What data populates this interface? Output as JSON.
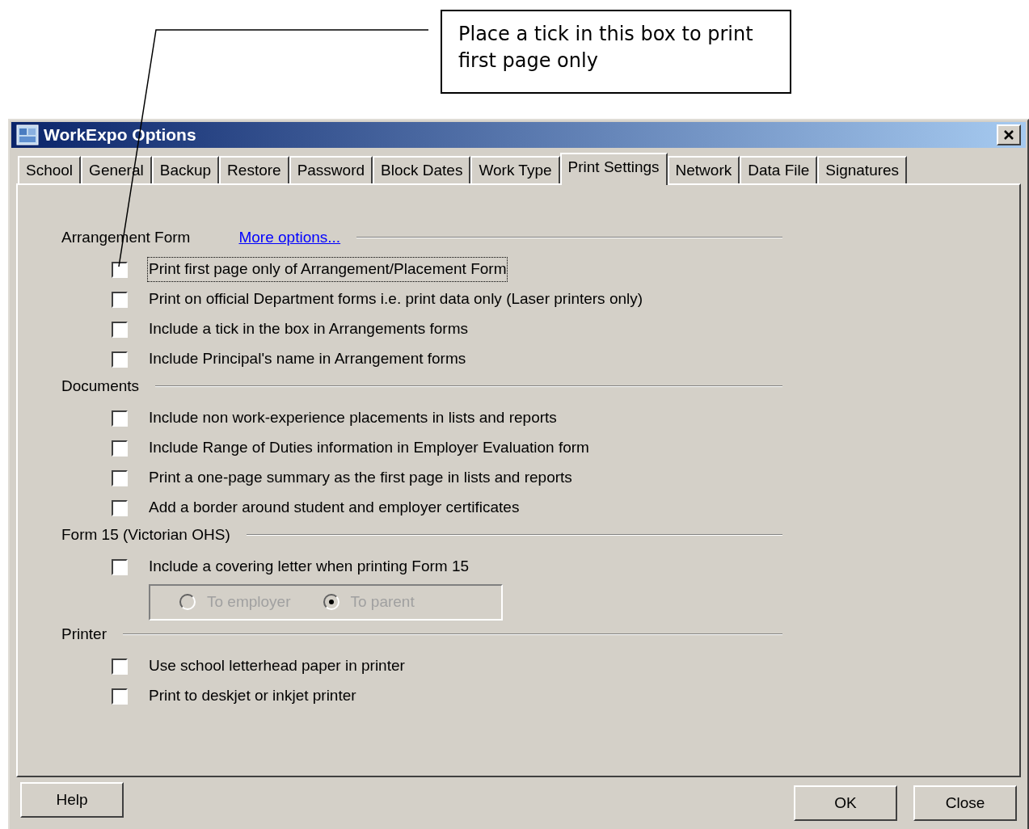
{
  "callout": {
    "text": "Place a tick in this box to print first page only"
  },
  "dialog": {
    "title": "WorkExpo Options",
    "tabs": [
      {
        "label": "School",
        "selected": false
      },
      {
        "label": "General",
        "selected": false
      },
      {
        "label": "Backup",
        "selected": false
      },
      {
        "label": "Restore",
        "selected": false
      },
      {
        "label": "Password",
        "selected": false
      },
      {
        "label": "Block Dates",
        "selected": false
      },
      {
        "label": "Work Type",
        "selected": false
      },
      {
        "label": "Print Settings",
        "selected": true
      },
      {
        "label": "Network",
        "selected": false
      },
      {
        "label": "Data File",
        "selected": false
      },
      {
        "label": "Signatures",
        "selected": false
      }
    ],
    "sections": [
      {
        "heading": "Arrangement Form",
        "link": "More options...",
        "items": [
          {
            "kind": "checkbox",
            "label": "Print first page only of Arrangement/Placement Form",
            "checked": false,
            "focused": true
          },
          {
            "kind": "checkbox",
            "label": "Print on official Department forms i.e. print data only (Laser printers only)",
            "checked": false,
            "focused": false
          },
          {
            "kind": "checkbox",
            "label": "Include a tick in the box in Arrangements forms",
            "checked": false,
            "focused": false
          },
          {
            "kind": "checkbox",
            "label": "Include Principal's name in Arrangement forms",
            "checked": false,
            "focused": false
          }
        ]
      },
      {
        "heading": "Documents",
        "items": [
          {
            "kind": "checkbox",
            "label": "Include non work-experience placements in lists and reports",
            "checked": false,
            "focused": false
          },
          {
            "kind": "checkbox",
            "label": "Include Range of Duties information in Employer Evaluation form",
            "checked": false,
            "focused": false
          },
          {
            "kind": "checkbox",
            "label": "Print a one-page summary as the first page in lists and reports",
            "checked": false,
            "focused": false
          },
          {
            "kind": "checkbox",
            "label": "Add a border around student and employer certificates",
            "checked": false,
            "focused": false
          }
        ]
      },
      {
        "heading": "Form 15 (Victorian OHS)",
        "items": [
          {
            "kind": "checkbox",
            "label": "Include a covering letter when printing Form 15",
            "checked": false,
            "focused": false
          },
          {
            "kind": "radio_group",
            "disabled": true,
            "options": [
              {
                "label": "To employer",
                "selected": false
              },
              {
                "label": "To parent",
                "selected": true
              }
            ]
          }
        ]
      },
      {
        "heading": "Printer",
        "items": [
          {
            "kind": "checkbox",
            "label": "Use school letterhead paper in printer",
            "checked": false,
            "focused": false
          },
          {
            "kind": "checkbox",
            "label": "Print to deskjet or inkjet printer",
            "checked": false,
            "focused": false
          }
        ]
      }
    ],
    "help_button": "Help",
    "action_buttons": [
      "OK",
      "Close"
    ]
  }
}
